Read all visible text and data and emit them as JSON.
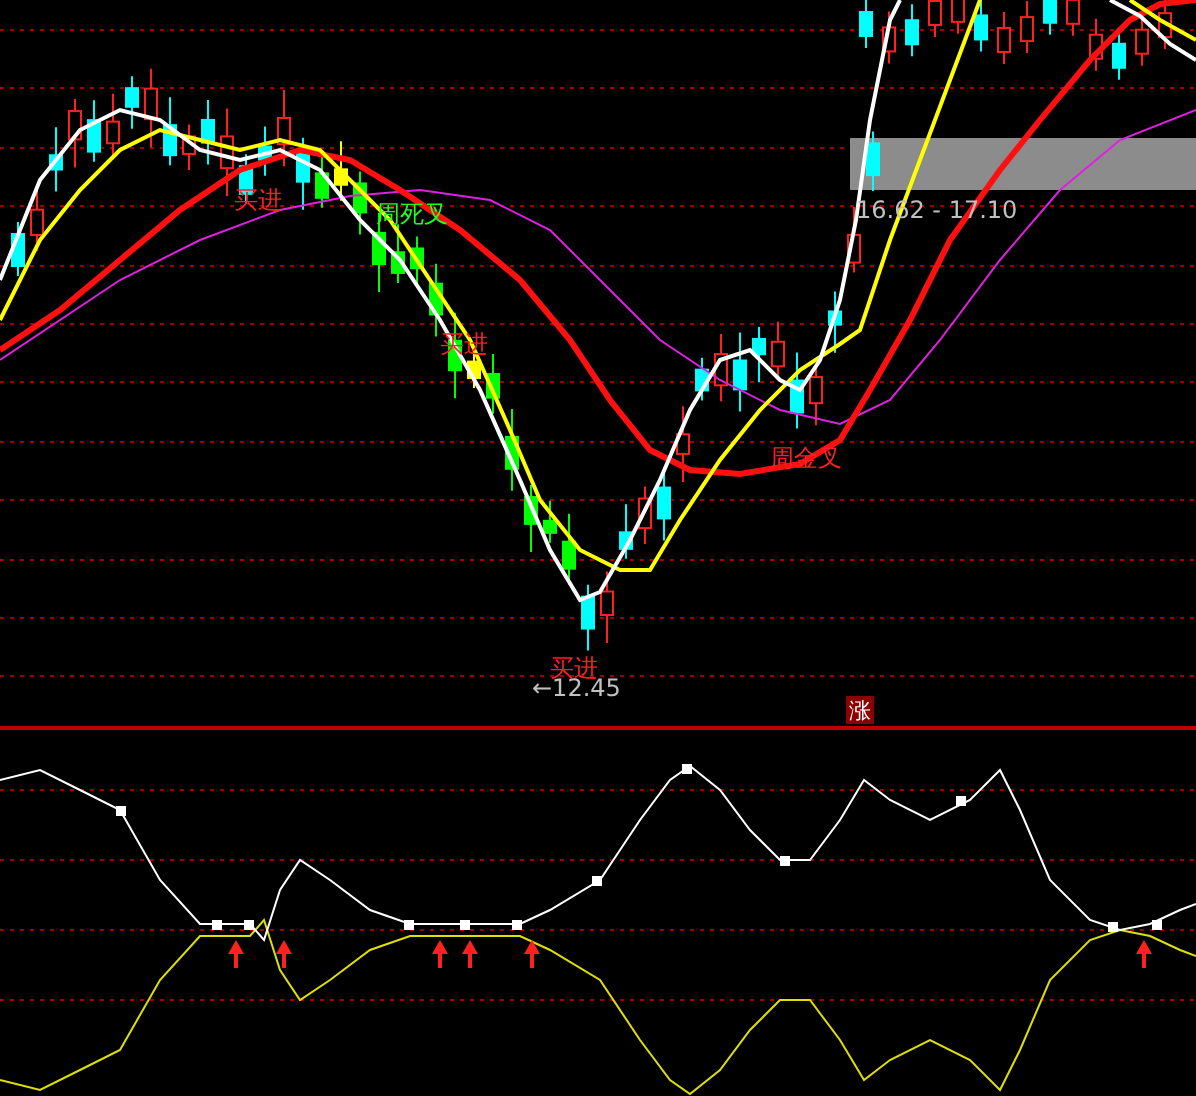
{
  "signals": [
    {
      "text": "买进",
      "kind": "buy"
    },
    {
      "text": "周死叉",
      "kind": "death_cross"
    },
    {
      "text": "买进",
      "kind": "buy"
    },
    {
      "text": "周金叉",
      "kind": "golden_cross"
    },
    {
      "text": "买进",
      "kind": "buy"
    }
  ],
  "range_label": "16.62 - 17.10",
  "low_label": "←12.45",
  "badge": "涨"
}
